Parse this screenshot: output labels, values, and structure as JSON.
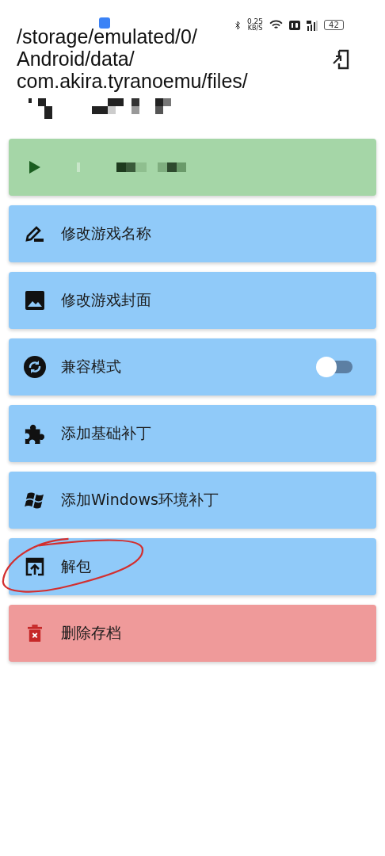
{
  "status_bar": {
    "speed": "0.25",
    "speed_unit": "KB/S",
    "battery": "42"
  },
  "header": {
    "path_lines": [
      "/storage/emulated/0/",
      "Android/data/",
      "com.akira.tyranoemu/files/"
    ]
  },
  "actions": [
    {
      "kind": "play"
    },
    {
      "kind": "action",
      "label": "修改游戏名称"
    },
    {
      "kind": "action",
      "label": "修改游戏封面"
    },
    {
      "kind": "toggle",
      "label": "兼容模式",
      "on": false
    },
    {
      "kind": "action",
      "label": "添加基础补丁"
    },
    {
      "kind": "action",
      "label": "添加Windows环境补丁"
    },
    {
      "kind": "action",
      "label": "解包",
      "circled": true
    },
    {
      "kind": "danger",
      "label": "删除存档"
    }
  ]
}
